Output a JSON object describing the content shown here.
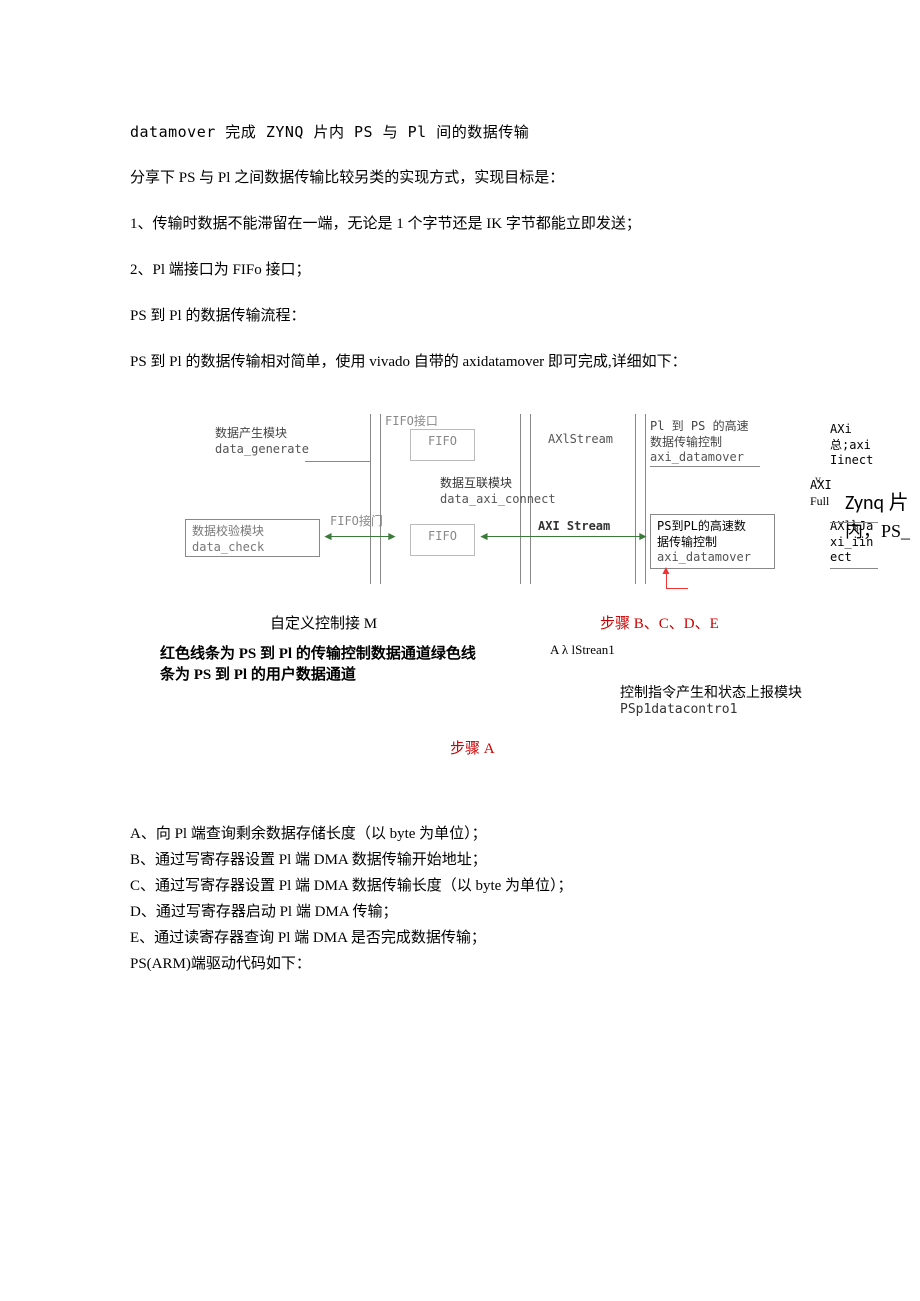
{
  "title": "datamover 完成 ZYNQ 片内 PS 与 Pl 间的数据传输",
  "intro": "分享下 PS 与 Pl 之间数据传输比较另类的实现方式，实现目标是：",
  "goal1": "1、传输时数据不能滞留在一端，无论是 1 个字节还是 IK 字节都能立即发送；",
  "goal2": "2、Pl 端接口为 FIFo 接口；",
  "flow_heading": "PS 到 Pl 的数据传输流程：",
  "flow_desc": "PS 到 Pl 的数据传输相对简单，使用 vivado 自带的 axidatamover 即可完成,详细如下：",
  "side_v": "v.",
  "side_zynq_line1": "Zynq 片",
  "side_zynq_line2": "内，PS_",
  "diagram": {
    "data_gen_cn": "数据产生模块",
    "data_gen_en": "data_generate",
    "data_check_cn": "数据校验模块",
    "data_check_en": "data_check",
    "fifo_label_top": "FIFO接口",
    "fifo_label_mid": "FIFO接门",
    "fifo": "FIFO",
    "axi_stream_top": "AXlStream",
    "axi_stream_mid": "AXI Stream",
    "connector_cn": "数据互联模块",
    "connector_en": "data_axi_connect",
    "p1ps_cn_line1": "Pl 到 PS 的高速",
    "p1ps_cn_line2": "数据传输控制",
    "p1ps_en": "axi_datamover",
    "psp1_cn_line1": "PS到PL的高速数",
    "psp1_cn_line2": "据传输控制",
    "psp1_en": "axi_datamover",
    "right1_l1": "AXi",
    "right1_l2": "总;axi",
    "right1_l3": "Iinect",
    "right2_l1": "AXI",
    "right2_l2": "Full",
    "right3_l1": "AXl⅛Ja",
    "right3_l2": "xi_iin",
    "right3_l3": "ect"
  },
  "caption_custom": "自定义控制接 M",
  "caption_steps_bcde": "步骤 B、C、D、E",
  "caption_red_line1": "红色线条为 PS 到 Pl 的传输控制数据通道绿色线",
  "caption_red_line2": "条为 PS 到 Pl 的用户数据通道",
  "caption_axistream": "A λ lStrean1",
  "caption_ctrl_mod_cn": "控制指令产生和状态上报模块",
  "caption_ctrl_mod_en": "PSp1datacontro1",
  "caption_step_a": "步骤 A",
  "steps": {
    "a": "A、向 Pl 端查询剩余数据存储长度（以 byte 为单位）；",
    "b": "B、通过写寄存器设置 Pl 端 DMA 数据传输开始地址；",
    "c": "C、通过写寄存器设置 Pl 端 DMA 数据传输长度（以 byte 为单位）；",
    "d": "D、通过写寄存器启动 Pl 端 DMA 传输；",
    "e": "E、通过读寄存器查询 Pl 端 DMA 是否完成数据传输；",
    "code": "PS(ARM)端驱动代码如下："
  }
}
